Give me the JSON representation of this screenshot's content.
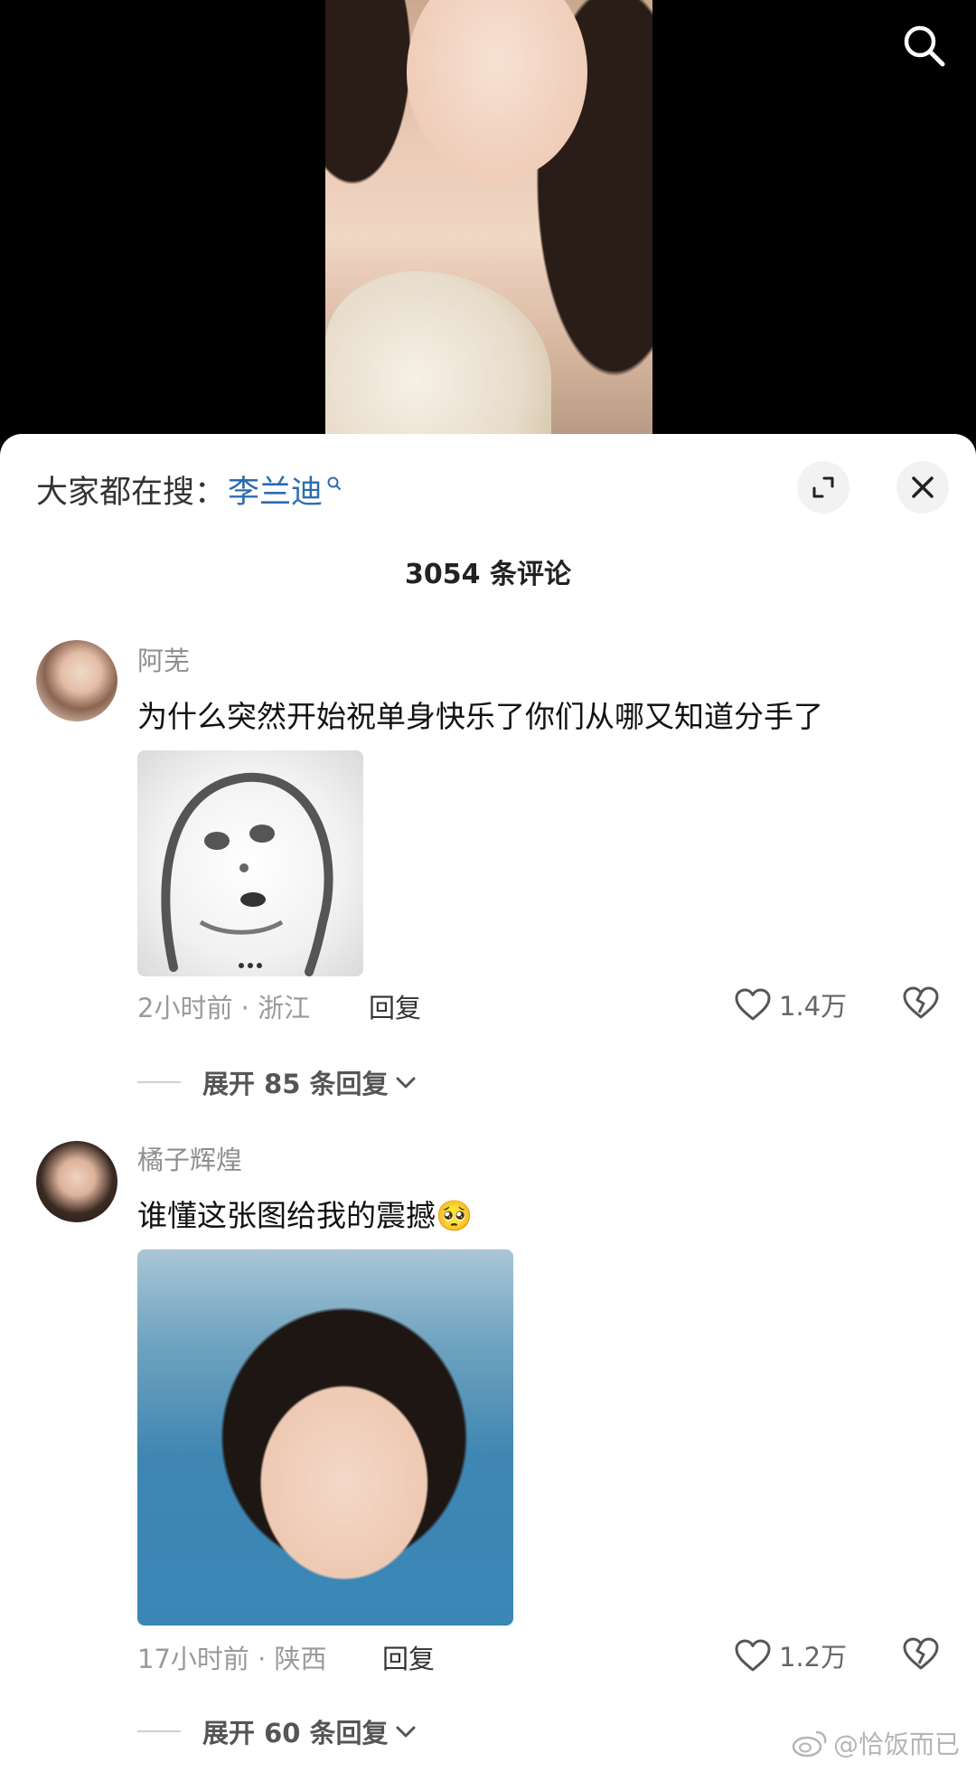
{
  "search": {
    "icon": "search-icon"
  },
  "sheet": {
    "trending_prefix": "大家都在搜：",
    "trending_keyword": "李兰迪",
    "comment_count": "3054 条评论"
  },
  "comments": [
    {
      "username": "阿芜",
      "text": "为什么突然开始祝单身快乐了你们从哪又知道分手了",
      "meta": "2小时前 · 浙江",
      "reply": "回复",
      "likes": "1.4万",
      "expand": "展开 85 条回复"
    },
    {
      "username": "橘子辉煌",
      "text": "谁懂这张图给我的震撼",
      "emoji": "🥺",
      "meta": "17小时前 · 陕西",
      "reply": "回复",
      "likes": "1.2万",
      "expand": "展开 60 条回复"
    }
  ],
  "watermark": "@恰饭而已"
}
